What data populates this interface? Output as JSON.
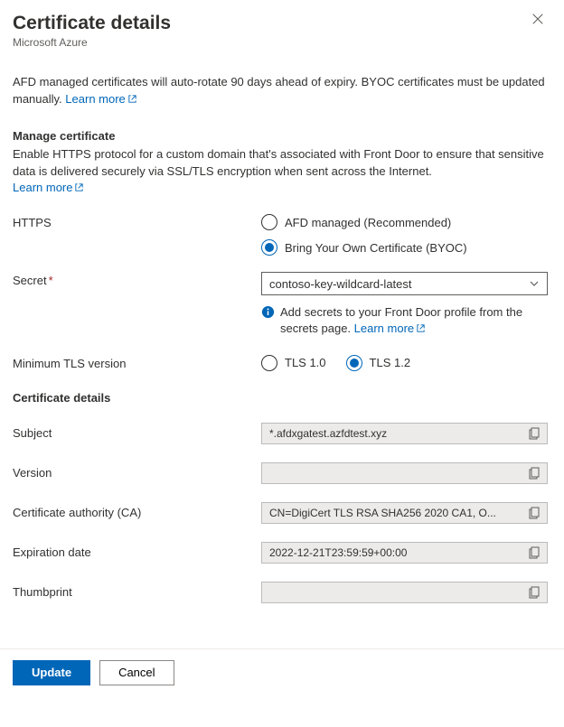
{
  "header": {
    "title": "Certificate details",
    "subtitle": "Microsoft Azure"
  },
  "info": {
    "text": "AFD managed certificates will auto-rotate 90 days ahead of expiry. BYOC certificates must be updated manually. ",
    "learn_more": "Learn more"
  },
  "manage": {
    "title": "Manage certificate",
    "desc": "Enable HTTPS protocol for a custom domain that's associated with Front Door to ensure that sensitive data is delivered securely via SSL/TLS encryption when sent across the Internet.",
    "learn_more": "Learn more"
  },
  "https": {
    "label": "HTTPS",
    "option_afd": "AFD managed (Recommended)",
    "option_byoc": "Bring Your Own Certificate (BYOC)"
  },
  "secret": {
    "label": "Secret",
    "value": "contoso-key-wildcard-latest",
    "helper": "Add secrets to your Front Door profile from the secrets page. ",
    "learn_more": "Learn more"
  },
  "tls": {
    "label": "Minimum TLS version",
    "option_10": "TLS 1.0",
    "option_12": "TLS 1.2"
  },
  "cert": {
    "section_title": "Certificate details",
    "subject_label": "Subject",
    "subject_value": "*.afdxgatest.azfdtest.xyz",
    "version_label": "Version",
    "version_value": "",
    "ca_label": "Certificate authority (CA)",
    "ca_value": "CN=DigiCert TLS RSA SHA256 2020 CA1, O...",
    "expiration_label": "Expiration date",
    "expiration_value": "2022-12-21T23:59:59+00:00",
    "thumbprint_label": "Thumbprint",
    "thumbprint_value": ""
  },
  "footer": {
    "update": "Update",
    "cancel": "Cancel"
  }
}
